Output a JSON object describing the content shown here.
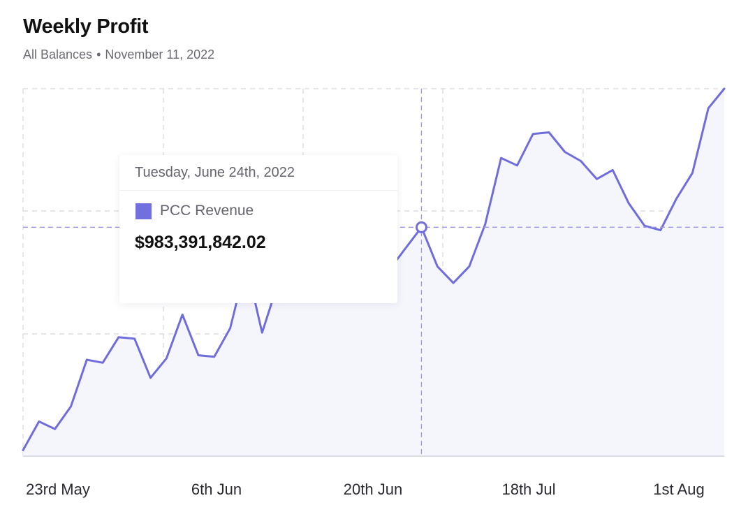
{
  "header": {
    "title": "Weekly Profit",
    "subtitle_left": "All Balances",
    "subtitle_sep": "•",
    "subtitle_right": "November 11, 2022"
  },
  "tooltip": {
    "date": "Tuesday, June 24th, 2022",
    "series_name": "PCC Revenue",
    "value": "$983,391,842.02",
    "swatch_color": "#7270e0"
  },
  "colors": {
    "line": "#6f6ddc",
    "area": "#f5f5fc",
    "grid": "#d6d6de",
    "crosshair": "#9b98ea"
  },
  "chart_data": {
    "type": "area",
    "title": "Weekly Profit",
    "x_tick_labels": [
      "23rd May",
      "6th Jun",
      "20th Jun",
      "18th Jul",
      "1st Aug"
    ],
    "highlighted_point": {
      "label": "Tuesday, June 24th, 2022",
      "series": "PCC Revenue",
      "value": 983391842.02
    },
    "series": [
      {
        "name": "PCC Revenue",
        "values": [
          0.04,
          0.23,
          0.18,
          0.33,
          0.64,
          0.62,
          0.79,
          0.78,
          0.52,
          0.65,
          0.94,
          0.67,
          0.66,
          0.85,
          1.28,
          0.82,
          1.15,
          1.34,
          1.24,
          1.22,
          1.55,
          1.37,
          1.22,
          1.24,
          1.38,
          1.52,
          1.26,
          1.15,
          1.26,
          1.54,
          1.98,
          1.93,
          2.14,
          2.15,
          2.02,
          1.96,
          1.84,
          1.9,
          1.68,
          1.53,
          1.5,
          1.71,
          1.88,
          2.31,
          2.44
        ]
      }
    ],
    "ylim": [
      0,
      2.44
    ],
    "grid": true,
    "legend": "tooltip"
  }
}
